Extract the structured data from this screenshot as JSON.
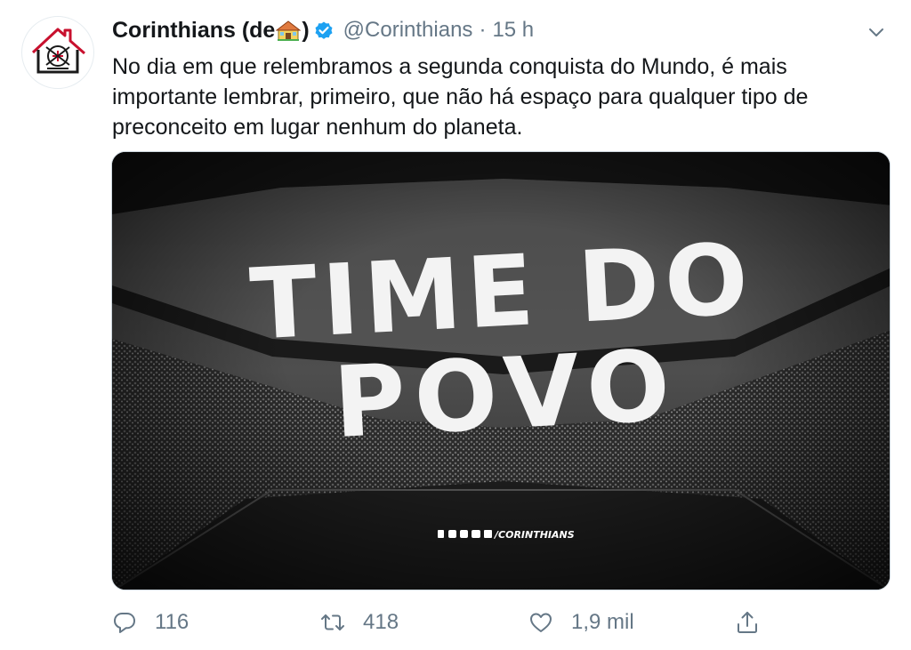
{
  "tweet": {
    "author_name": "Corinthians (de",
    "author_suffix": ")",
    "handle": "@Corinthians",
    "separator": "·",
    "time": "15 h",
    "text": "No dia em que relembramos a segunda conquista do Mundo, é mais importante lembrar, primeiro, que não há espaço para qualquer tipo de preconceito em lugar nenhum do planeta."
  },
  "media": {
    "headline_line1": "TIME DO",
    "headline_line2": "POVO",
    "social_handle": "/CORINTHIANS"
  },
  "actions": {
    "replies": "116",
    "retweets": "418",
    "likes": "1,9 mil"
  },
  "colors": {
    "verified": "#1da1f2",
    "icon_gray": "#657786",
    "brand_red": "#c8102e"
  }
}
